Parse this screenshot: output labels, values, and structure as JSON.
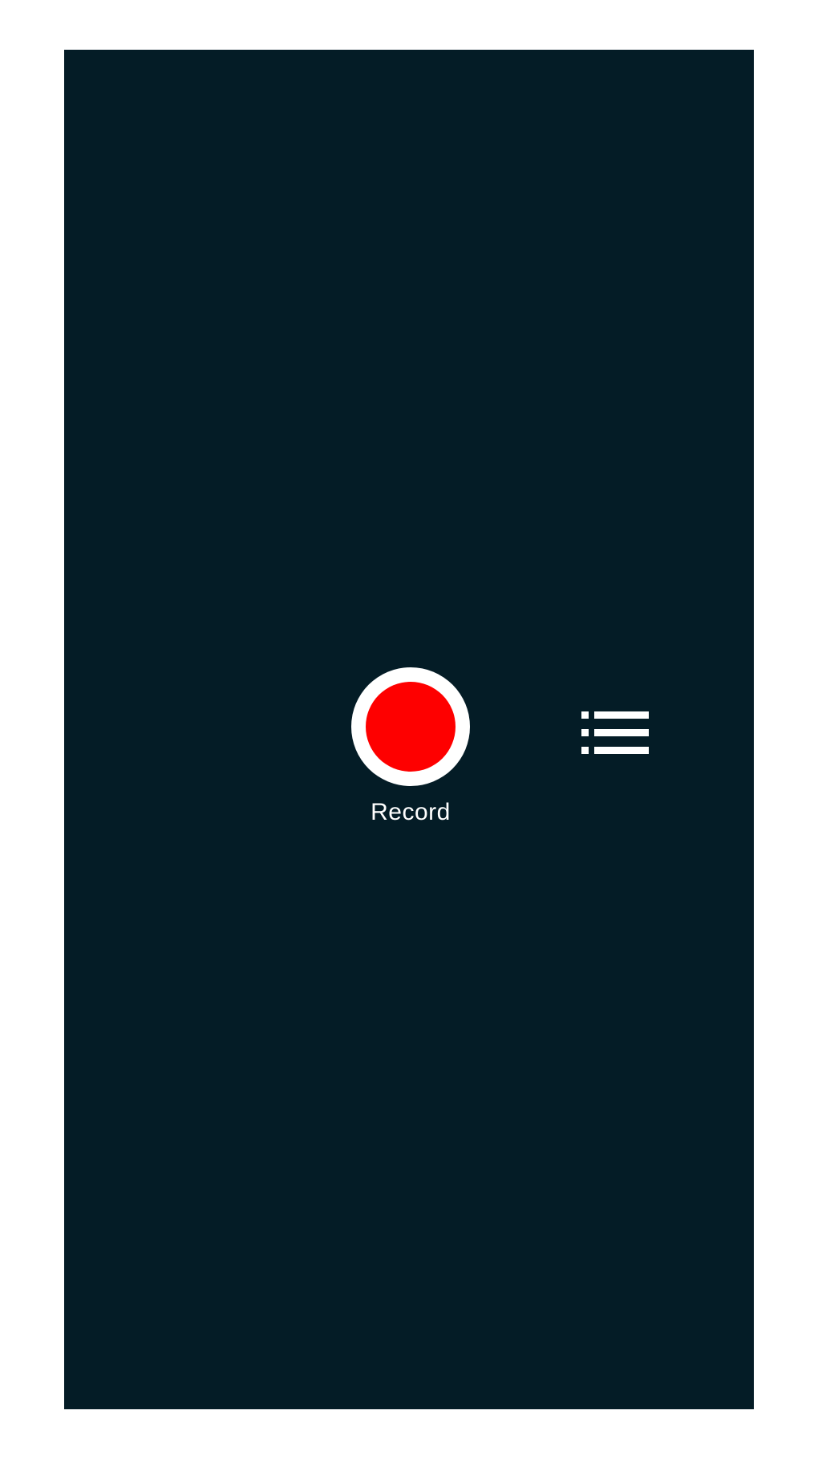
{
  "screen": {
    "background_color": "#041c26"
  },
  "record": {
    "label": "Record",
    "button_color": "#fe0000",
    "ring_color": "#ffffff"
  },
  "recordings_list": {
    "icon": "list-icon"
  }
}
